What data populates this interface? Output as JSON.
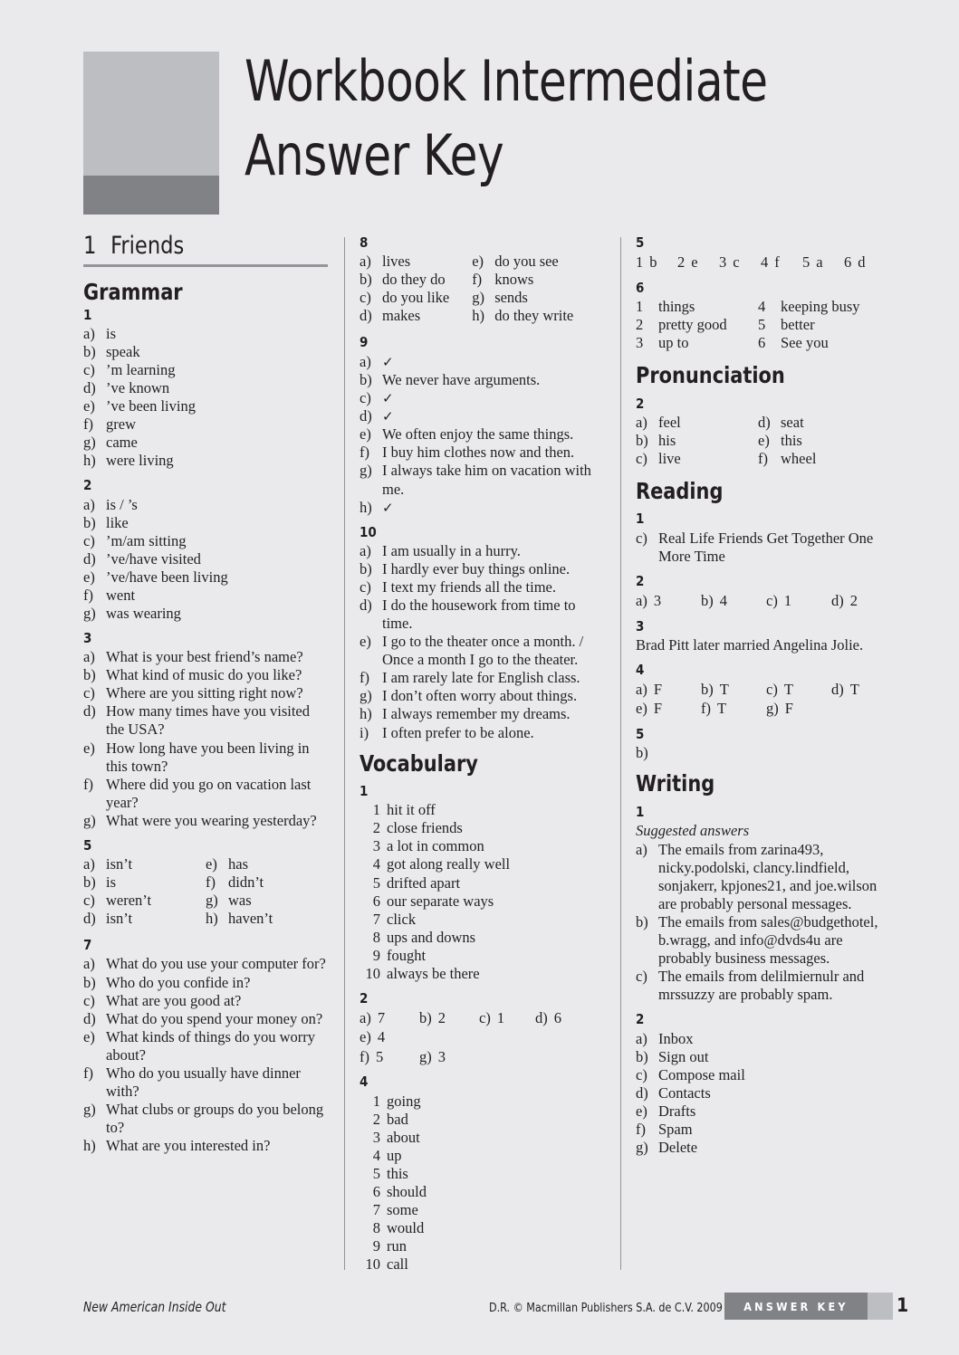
{
  "masthead": {
    "title_line1": "Workbook Intermediate",
    "title_line2": "Answer Key"
  },
  "unit": {
    "number": "1",
    "name": "Friends"
  },
  "colors": {
    "page_background": "#eaeaec",
    "logo_light": "#bcbec1",
    "logo_dark": "#808285",
    "rule": "#939598",
    "text": "#231f20",
    "badge_background": "#808285",
    "badge_text": "#ffffff"
  },
  "sections": {
    "grammar": {
      "heading": "Grammar",
      "ex1": {
        "number": "1",
        "items": [
          {
            "label": "a)",
            "text": "is"
          },
          {
            "label": "b)",
            "text": "speak"
          },
          {
            "label": "c)",
            "text": "’m learning"
          },
          {
            "label": "d)",
            "text": "’ve known"
          },
          {
            "label": "e)",
            "text": "’ve been living"
          },
          {
            "label": "f)",
            "text": "grew"
          },
          {
            "label": "g)",
            "text": "came"
          },
          {
            "label": "h)",
            "text": "were living"
          }
        ]
      },
      "ex2": {
        "number": "2",
        "items": [
          {
            "label": "a)",
            "text": "is / ’s"
          },
          {
            "label": "b)",
            "text": "like"
          },
          {
            "label": "c)",
            "text": "’m/am sitting"
          },
          {
            "label": "d)",
            "text": "’ve/have visited"
          },
          {
            "label": "e)",
            "text": "’ve/have been living"
          },
          {
            "label": "f)",
            "text": "went"
          },
          {
            "label": "g)",
            "text": "was wearing"
          }
        ]
      },
      "ex3": {
        "number": "3",
        "items": [
          {
            "label": "a)",
            "text": "What is your best friend’s name?"
          },
          {
            "label": "b)",
            "text": "What kind of music do you like?"
          },
          {
            "label": "c)",
            "text": "Where are you sitting right now?"
          },
          {
            "label": "d)",
            "text": "How many times have you visited the USA?"
          },
          {
            "label": "e)",
            "text": "How long have you been living in this town?"
          },
          {
            "label": "f)",
            "text": "Where did you go on vacation last year?"
          },
          {
            "label": "g)",
            "text": "What were you wearing yesterday?"
          }
        ]
      },
      "ex5": {
        "number": "5",
        "col_left": [
          {
            "label": "a)",
            "text": "isn’t"
          },
          {
            "label": "b)",
            "text": "is"
          },
          {
            "label": "c)",
            "text": "weren’t"
          },
          {
            "label": "d)",
            "text": "isn’t"
          }
        ],
        "col_right": [
          {
            "label": "e)",
            "text": "has"
          },
          {
            "label": "f)",
            "text": "didn’t"
          },
          {
            "label": "g)",
            "text": "was"
          },
          {
            "label": "h)",
            "text": "haven’t"
          }
        ]
      },
      "ex7": {
        "number": "7",
        "items": [
          {
            "label": "a)",
            "text": "What do you use your computer for?"
          },
          {
            "label": "b)",
            "text": "Who do you confide in?"
          },
          {
            "label": "c)",
            "text": "What are you good at?"
          },
          {
            "label": "d)",
            "text": "What do you spend your money on?"
          },
          {
            "label": "e)",
            "text": "What kinds of things do you worry about?"
          },
          {
            "label": "f)",
            "text": "Who do you usually have dinner with?"
          },
          {
            "label": "g)",
            "text": "What clubs or groups do you belong to?"
          },
          {
            "label": "h)",
            "text": "What are you interested in?"
          }
        ]
      },
      "ex8": {
        "number": "8",
        "col_left": [
          {
            "label": "a)",
            "text": "lives"
          },
          {
            "label": "b)",
            "text": "do they do"
          },
          {
            "label": "c)",
            "text": "do you like"
          },
          {
            "label": "d)",
            "text": "makes"
          }
        ],
        "col_right": [
          {
            "label": "e)",
            "text": "do you see"
          },
          {
            "label": "f)",
            "text": "knows"
          },
          {
            "label": "g)",
            "text": "sends"
          },
          {
            "label": "h)",
            "text": "do they write"
          }
        ]
      },
      "ex9": {
        "number": "9",
        "items": [
          {
            "label": "a)",
            "text": "✓"
          },
          {
            "label": "b)",
            "text": "We never have arguments."
          },
          {
            "label": "c)",
            "text": "✓"
          },
          {
            "label": "d)",
            "text": "✓"
          },
          {
            "label": "e)",
            "text": "We often enjoy the same things."
          },
          {
            "label": "f)",
            "text": "I buy him clothes now and then."
          },
          {
            "label": "g)",
            "text": "I always take him on vacation with me."
          },
          {
            "label": "h)",
            "text": "✓"
          }
        ]
      },
      "ex10": {
        "number": "10",
        "items": [
          {
            "label": "a)",
            "text": "I am usually in a hurry."
          },
          {
            "label": "b)",
            "text": "I hardly ever buy things online."
          },
          {
            "label": "c)",
            "text": "I text my friends all the time."
          },
          {
            "label": "d)",
            "text": "I do the housework from time to time."
          },
          {
            "label": "e)",
            "text": "I go to the theater once a month. / Once a month I go to the theater."
          },
          {
            "label": "f)",
            "text": "I am rarely late for English class."
          },
          {
            "label": "g)",
            "text": "I don’t often worry about things."
          },
          {
            "label": "h)",
            "text": "I always remember my dreams."
          },
          {
            "label": "i)",
            "text": "I often prefer to be alone."
          }
        ]
      }
    },
    "vocabulary": {
      "heading": "Vocabulary",
      "ex1": {
        "number": "1",
        "items": [
          {
            "label": "1",
            "text": "hit it off"
          },
          {
            "label": "2",
            "text": "close friends"
          },
          {
            "label": "3",
            "text": "a lot in common"
          },
          {
            "label": "4",
            "text": "got along really well"
          },
          {
            "label": "5",
            "text": "drifted apart"
          },
          {
            "label": "6",
            "text": "our separate ways"
          },
          {
            "label": "7",
            "text": "click"
          },
          {
            "label": "8",
            "text": "ups and downs"
          },
          {
            "label": "9",
            "text": "fought"
          },
          {
            "label": "10",
            "text": "always be there"
          }
        ]
      },
      "ex2": {
        "number": "2",
        "row1": [
          {
            "label": "a)",
            "text": "7"
          },
          {
            "label": "b)",
            "text": "2"
          },
          {
            "label": "c)",
            "text": "1"
          },
          {
            "label": "d)",
            "text": "6"
          },
          {
            "label": "e)",
            "text": "4"
          }
        ],
        "row2": [
          {
            "label": "f)",
            "text": "5"
          },
          {
            "label": "g)",
            "text": "3"
          }
        ]
      },
      "ex4": {
        "number": "4",
        "items": [
          {
            "label": "1",
            "text": "going"
          },
          {
            "label": "2",
            "text": "bad"
          },
          {
            "label": "3",
            "text": "about"
          },
          {
            "label": "4",
            "text": "up"
          },
          {
            "label": "5",
            "text": "this"
          },
          {
            "label": "6",
            "text": "should"
          },
          {
            "label": "7",
            "text": "some"
          },
          {
            "label": "8",
            "text": "would"
          },
          {
            "label": "9",
            "text": "run"
          },
          {
            "label": "10",
            "text": "call"
          }
        ]
      },
      "ex5": {
        "number": "5",
        "pairs": [
          {
            "label": "1",
            "text": "b"
          },
          {
            "label": "2",
            "text": "e"
          },
          {
            "label": "3",
            "text": "c"
          },
          {
            "label": "4",
            "text": "f"
          },
          {
            "label": "5",
            "text": "a"
          },
          {
            "label": "6",
            "text": "d"
          }
        ]
      },
      "ex6": {
        "number": "6",
        "col_left": [
          {
            "label": "1",
            "text": "things"
          },
          {
            "label": "2",
            "text": "pretty good"
          },
          {
            "label": "3",
            "text": "up to"
          }
        ],
        "col_right": [
          {
            "label": "4",
            "text": "keeping busy"
          },
          {
            "label": "5",
            "text": "better"
          },
          {
            "label": "6",
            "text": "See you"
          }
        ]
      }
    },
    "pronunciation": {
      "heading": "Pronunciation",
      "ex2": {
        "number": "2",
        "col_left": [
          {
            "label": "a)",
            "text": "feel"
          },
          {
            "label": "b)",
            "text": "his"
          },
          {
            "label": "c)",
            "text": "live"
          }
        ],
        "col_right": [
          {
            "label": "d)",
            "text": "seat"
          },
          {
            "label": "e)",
            "text": "this"
          },
          {
            "label": "f)",
            "text": "wheel"
          }
        ]
      }
    },
    "reading": {
      "heading": "Reading",
      "ex1": {
        "number": "1",
        "items": [
          {
            "label": "c)",
            "text": "Real Life Friends Get Together One More Time"
          }
        ]
      },
      "ex2": {
        "number": "2",
        "row1": [
          {
            "label": "a)",
            "text": "3"
          },
          {
            "label": "b)",
            "text": "4"
          },
          {
            "label": "c)",
            "text": "1"
          },
          {
            "label": "d)",
            "text": "2"
          }
        ]
      },
      "ex3": {
        "number": "3",
        "text": "Brad Pitt later married Angelina Jolie."
      },
      "ex4": {
        "number": "4",
        "row1": [
          {
            "label": "a)",
            "text": "F"
          },
          {
            "label": "b)",
            "text": "T"
          },
          {
            "label": "c)",
            "text": "T"
          },
          {
            "label": "d)",
            "text": "T"
          }
        ],
        "row2": [
          {
            "label": "e)",
            "text": "F"
          },
          {
            "label": "f)",
            "text": "T"
          },
          {
            "label": "g)",
            "text": "F"
          }
        ]
      },
      "ex5": {
        "number": "5",
        "items": [
          {
            "label": "b)",
            "text": ""
          }
        ]
      }
    },
    "writing": {
      "heading": "Writing",
      "ex1": {
        "number": "1",
        "note": "Suggested answers",
        "items": [
          {
            "label": "a)",
            "text": "The emails from zarina493, nicky.podolski, clancy.lindfield, sonjakerr, kpjones21, and joe.wilson are probably personal messages."
          },
          {
            "label": "b)",
            "text": "The emails from sales@budgethotel, b.wragg, and info@dvds4u are probably business messages."
          },
          {
            "label": "c)",
            "text": "The emails from delilmiernulr and mrssuzzy are probably spam."
          }
        ]
      },
      "ex2": {
        "number": "2",
        "items": [
          {
            "label": "a)",
            "text": "Inbox"
          },
          {
            "label": "b)",
            "text": "Sign out"
          },
          {
            "label": "c)",
            "text": "Compose mail"
          },
          {
            "label": "d)",
            "text": "Contacts"
          },
          {
            "label": "e)",
            "text": "Drafts"
          },
          {
            "label": "f)",
            "text": "Spam"
          },
          {
            "label": "g)",
            "text": "Delete"
          }
        ]
      }
    }
  },
  "footer": {
    "book_title": "New American Inside Out",
    "copyright": "D.R. © Macmillan Publishers S.A. de C.V. 2009",
    "badge_label": "ANSWER KEY",
    "page_number": "1"
  }
}
